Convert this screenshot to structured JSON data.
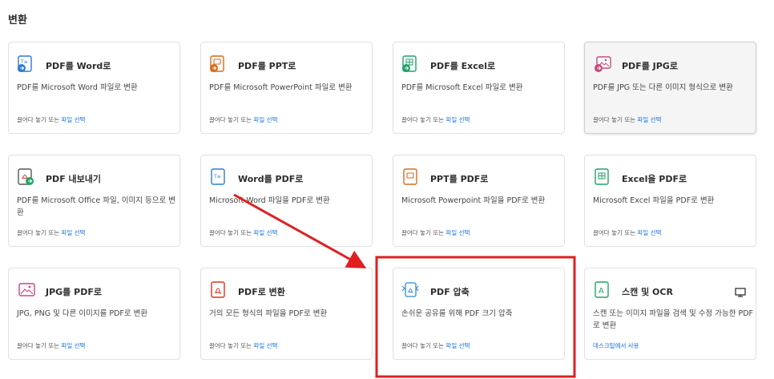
{
  "section": {
    "title": "변환"
  },
  "footer_text": {
    "drag_prefix": "끌어다 놓기 또는",
    "select_file": "파일 선택"
  },
  "cards": {
    "pdf_to_word": {
      "title": "PDF를 Word로",
      "desc": "PDF를 Microsoft Word 파일로 변환",
      "icon": "word-doc-icon"
    },
    "pdf_to_ppt": {
      "title": "PDF를 PPT로",
      "desc": "PDF를 Microsoft PowerPoint 파일로 변환",
      "icon": "ppt-doc-icon"
    },
    "pdf_to_excel": {
      "title": "PDF를 Excel로",
      "desc": "PDF를 Microsoft Excel 파일로 변환",
      "icon": "excel-doc-icon"
    },
    "pdf_to_jpg": {
      "title": "PDF를 JPG로",
      "desc": "PDF를 JPG 또는 다른 이미지 형식으로 변환",
      "icon": "image-doc-icon"
    },
    "export_pdf": {
      "title": "PDF 내보내기",
      "desc": "PDF를 Microsoft Office 파일, 이미지 등으로 변환",
      "icon": "export-pdf-icon"
    },
    "word_to_pdf": {
      "title": "Word를 PDF로",
      "desc": "Microsoft Word 파일을 PDF로 변환",
      "icon": "word-icon"
    },
    "ppt_to_pdf": {
      "title": "PPT를 PDF로",
      "desc": "Microsoft Powerpoint 파일을 PDF로 변환",
      "icon": "ppt-icon"
    },
    "excel_to_pdf": {
      "title": "Excel을 PDF로",
      "desc": "Microsoft Excel 파일을 PDF로 변환",
      "icon": "excel-icon"
    },
    "jpg_to_pdf": {
      "title": "JPG를 PDF로",
      "desc": "JPG, PNG 및 다른 이미지를 PDF로 변환",
      "icon": "image-icon"
    },
    "convert_to_pdf": {
      "title": "PDF로 변환",
      "desc": "거의 모든 형식의 파일을 PDF로 변환",
      "icon": "pdf-icon"
    },
    "compress_pdf": {
      "title": "PDF 압축",
      "desc": "손쉬운 공유를 위해 PDF 크기 압축",
      "icon": "compress-icon"
    },
    "scan_ocr": {
      "title": "스캔 및 OCR",
      "desc": "스캔 또는 이미지 파일을 검색 및 수정 가능한 PDF로 변환",
      "icon": "scan-ocr-icon",
      "footer": "데스크탑에서 사용",
      "extra_icon": "desktop-monitor-icon"
    }
  },
  "colors": {
    "highlight": "#e02020",
    "link": "#1473e6",
    "word": "#2b7cd3",
    "ppt": "#d86b1c",
    "excel": "#21a366",
    "image": "#c9487d",
    "pdf": "#e0301e",
    "compress": "#2b8ad8"
  }
}
